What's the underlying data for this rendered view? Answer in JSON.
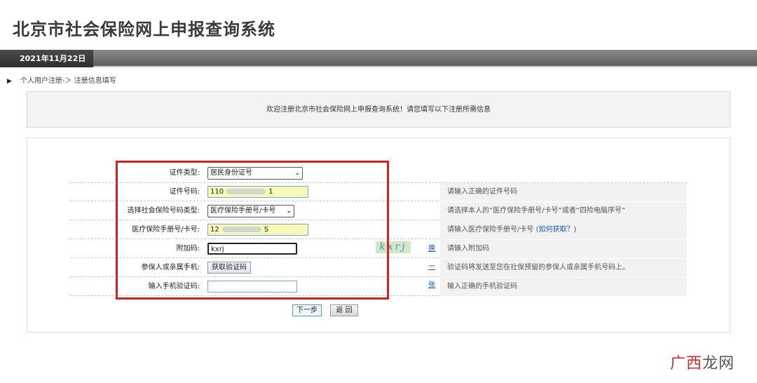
{
  "header": {
    "title": "北京市社会保险网上申报查询系统"
  },
  "topbar": {
    "date": "2021年11月22日"
  },
  "breadcrumb": {
    "arrow": "▶",
    "text": "个人用户注册-＞ 注册信息填写"
  },
  "welcome": "欢迎注册北京市社会保险网上申报查询系统！请您填写以下注册所需信息",
  "form": {
    "id_type": {
      "label": "证件类型:",
      "value": "居民身份证号"
    },
    "id_number": {
      "label": "证件号码:",
      "prefix": "110",
      "suffix": "1",
      "hint": "请输入正确的证件号码"
    },
    "insurance_type": {
      "label": "选择社会保险号码类型:",
      "value": "医疗保险手册号/卡号",
      "hint": "请选择本人的“医疗保险手册号/卡号”或者“四险电脑序号”"
    },
    "medical_number": {
      "label": "医疗保险手册号/卡号:",
      "prefix": "12",
      "suffix": "S",
      "hint": "请输入医疗保险手册号/卡号",
      "hint_link": "(如何获取？)"
    },
    "captcha": {
      "label": "附加码:",
      "value": "kxrj",
      "image_text": "kxrj",
      "refresh": "换一张",
      "hint": "请输入附加码"
    },
    "phone": {
      "label": "参保人或亲属手机:",
      "button": "获取验证码",
      "hint": "验证码将发送至您在社保预留的参保人或亲属手机号码上。"
    },
    "sms_code": {
      "label": "输入手机验证码:",
      "value": "",
      "hint": "输入正确的手机验证码"
    }
  },
  "actions": {
    "next": "下一步",
    "back": "返 回"
  },
  "watermark": {
    "red": "广西",
    "black": "龙网"
  },
  "colors": {
    "highlight_border": "#d42222",
    "input_fill": "#f8f8b8",
    "link": "#1a56b0"
  },
  "icons": {
    "select_chevron": "chevron-down-icon",
    "breadcrumb_arrow": "triangle-right-icon"
  }
}
